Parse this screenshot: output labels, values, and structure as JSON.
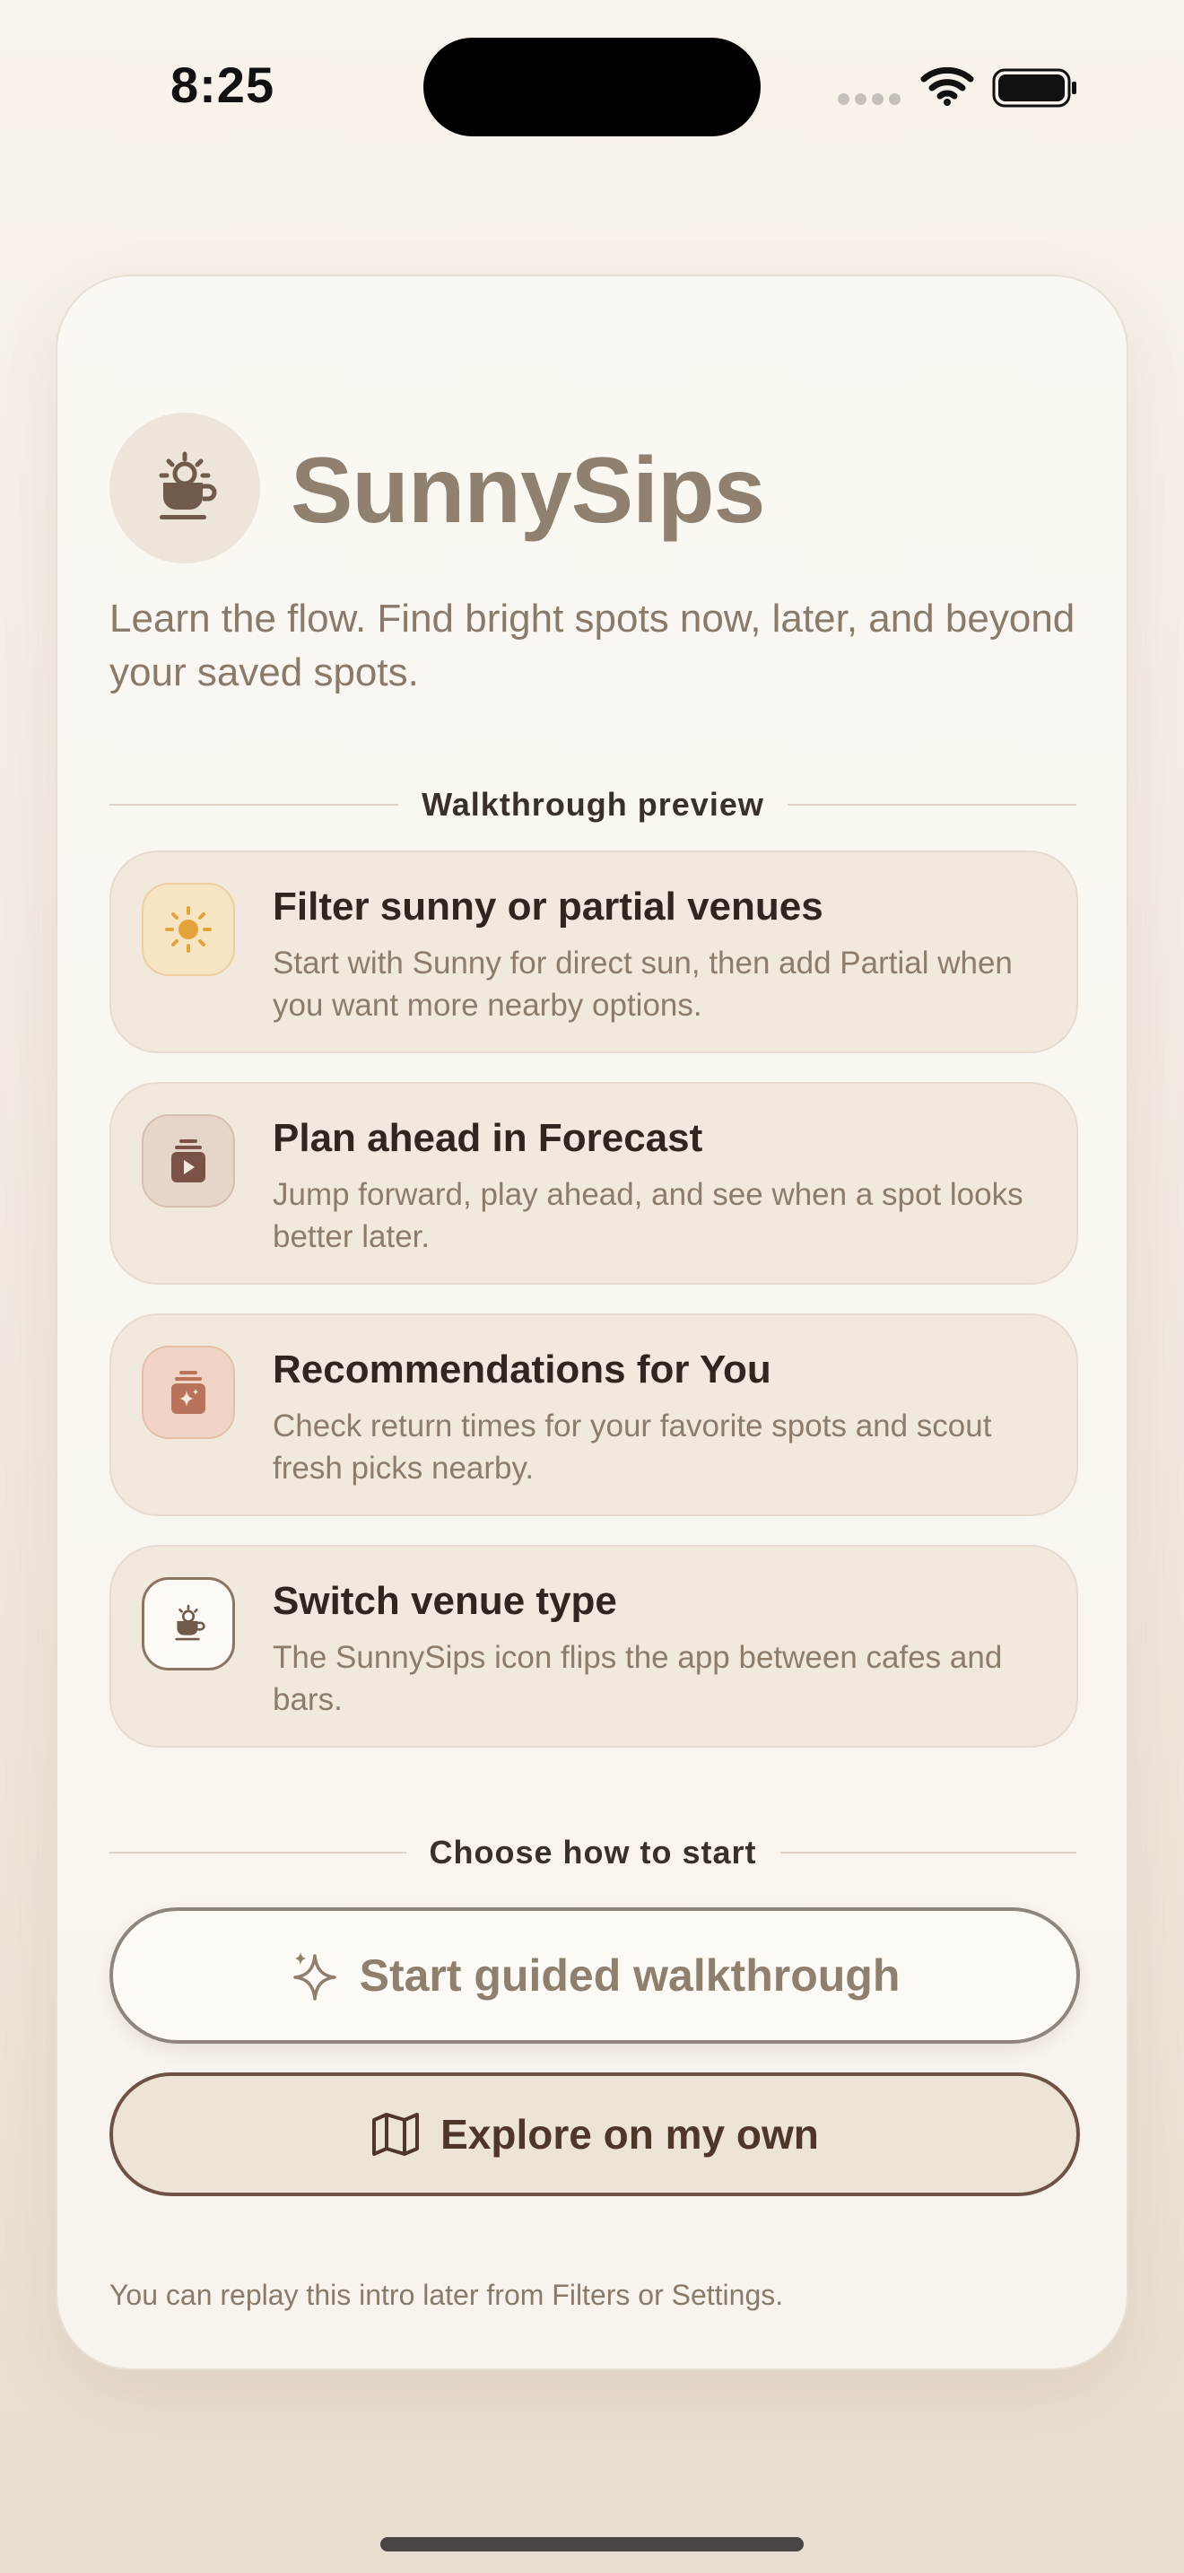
{
  "status_bar": {
    "time": "8:25"
  },
  "app": {
    "title": "SunnySips",
    "subtitle": "Learn the flow. Find bright spots now, later, and beyond your saved spots."
  },
  "sections": {
    "walkthrough_label": "Walkthrough preview",
    "choose_label": "Choose how to start"
  },
  "features": [
    {
      "title": "Filter sunny or partial venues",
      "description": "Start with Sunny for direct sun, then add Partial when you want more nearby options.",
      "icon": "sun-icon"
    },
    {
      "title": "Plan ahead in Forecast",
      "description": "Jump forward, play ahead, and see when a spot looks better later.",
      "icon": "play-stack-icon"
    },
    {
      "title": "Recommendations for You",
      "description": "Check return times for your favorite spots and scout fresh picks nearby.",
      "icon": "sparkle-stack-icon"
    },
    {
      "title": "Switch venue type",
      "description": "The SunnySips icon flips the app between cafes and bars.",
      "icon": "sunny-cup-icon"
    }
  ],
  "buttons": {
    "guided": "Start guided walkthrough",
    "explore": "Explore on my own"
  },
  "footnote": "You can replay this intro later from Filters or Settings.",
  "colors": {
    "background": "#f4ede4",
    "title": "#8f806f",
    "sun_accent": "#e2a33b",
    "forecast_accent": "#7a5346",
    "recommend_accent": "#b8735a",
    "button_border_dark": "#6e5245"
  }
}
